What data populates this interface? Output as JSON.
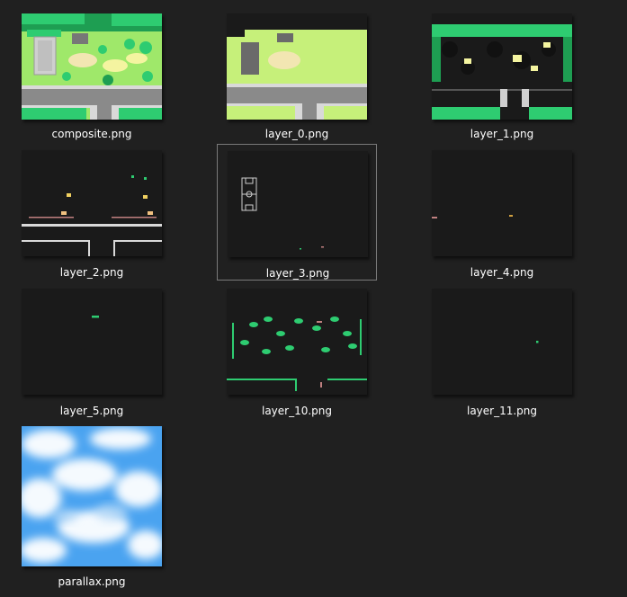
{
  "files": [
    {
      "name": "composite.png",
      "thumbnail": "park-composite-map"
    },
    {
      "name": "layer_0.png",
      "thumbnail": "ground-layer"
    },
    {
      "name": "layer_1.png",
      "thumbnail": "trees-and-buildings-layer"
    },
    {
      "name": "layer_2.png",
      "thumbnail": "road-markings-layer"
    },
    {
      "name": "layer_3.png",
      "thumbnail": "basketball-court-layer",
      "selected": true
    },
    {
      "name": "layer_4.png",
      "thumbnail": "sparse-detail-layer"
    },
    {
      "name": "layer_5.png",
      "thumbnail": "sparse-detail-layer"
    },
    {
      "name": "layer_10.png",
      "thumbnail": "shrubs-and-hedges-layer"
    },
    {
      "name": "layer_11.png",
      "thumbnail": "sparse-detail-layer"
    },
    {
      "name": "parallax.png",
      "thumbnail": "clouds-sky-texture"
    }
  ],
  "colors": {
    "background": "#202020",
    "grass_light": "#c6f07a",
    "grass_dark": "#2ecc71",
    "road": "#8a8a8a",
    "sky": "#4aa3f0"
  }
}
